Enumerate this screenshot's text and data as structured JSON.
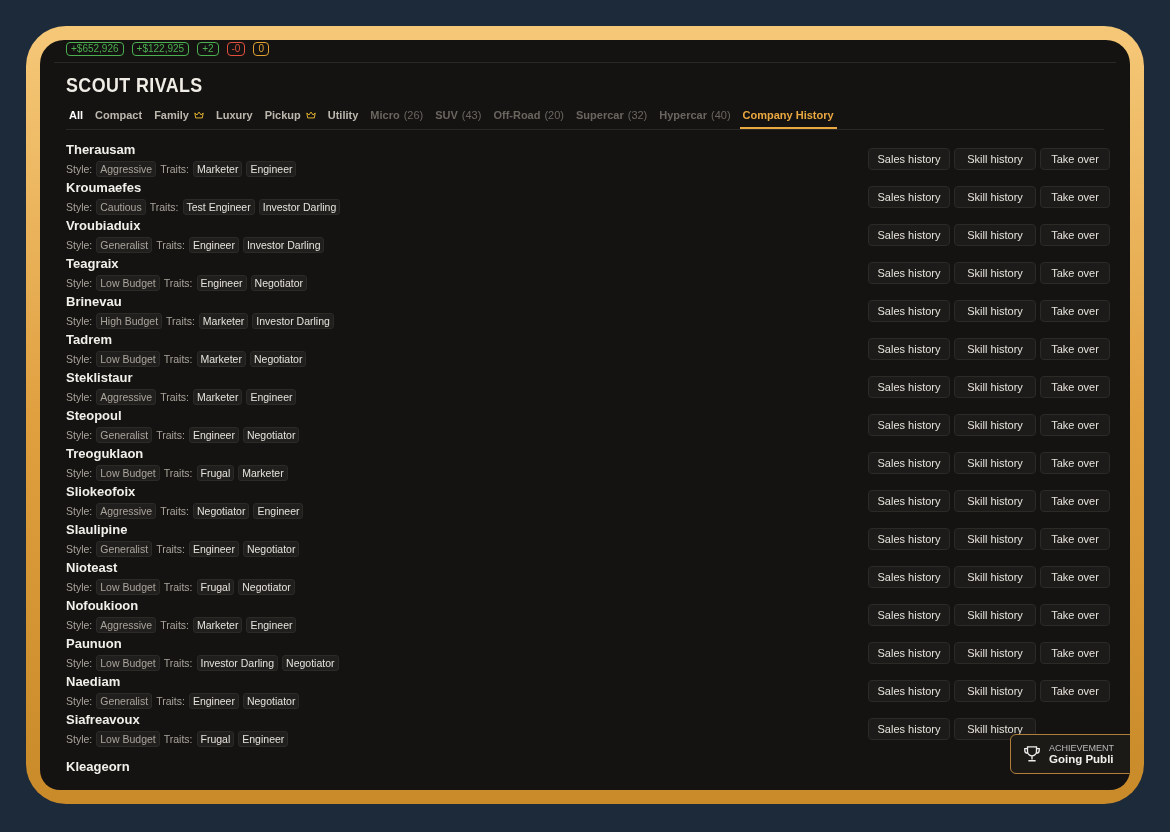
{
  "stats": [
    {
      "text": "+$652,926",
      "color": "#4caf50"
    },
    {
      "text": "+$122,925",
      "color": "#4caf50"
    },
    {
      "text": "+2",
      "color": "#4caf50"
    },
    {
      "text": "-0",
      "color": "#e0503c"
    },
    {
      "text": "0",
      "color": "#e0a030"
    }
  ],
  "title": "SCOUT RIVALS",
  "tabs": [
    {
      "label": "All",
      "kind": "filter",
      "selected": true,
      "disabled": false,
      "crown": false
    },
    {
      "label": "Compact",
      "kind": "filter",
      "selected": false,
      "disabled": false,
      "crown": false
    },
    {
      "label": "Family",
      "kind": "filter",
      "selected": false,
      "disabled": false,
      "crown": true
    },
    {
      "label": "Luxury",
      "kind": "filter",
      "selected": false,
      "disabled": false,
      "crown": false
    },
    {
      "label": "Pickup",
      "kind": "filter",
      "selected": false,
      "disabled": false,
      "crown": true
    },
    {
      "label": "Utility",
      "kind": "filter",
      "selected": false,
      "disabled": false,
      "crown": false
    },
    {
      "label": "Micro",
      "count": "(26)",
      "kind": "filter",
      "selected": false,
      "disabled": true,
      "crown": false
    },
    {
      "label": "SUV",
      "count": "(43)",
      "kind": "filter",
      "selected": false,
      "disabled": true,
      "crown": false
    },
    {
      "label": "Off-Road",
      "count": "(20)",
      "kind": "filter",
      "selected": false,
      "disabled": true,
      "crown": false
    },
    {
      "label": "Supercar",
      "count": "(32)",
      "kind": "filter",
      "selected": false,
      "disabled": true,
      "crown": false
    },
    {
      "label": "Hypercar",
      "count": "(40)",
      "kind": "filter",
      "selected": false,
      "disabled": true,
      "crown": false
    },
    {
      "label": "Company History",
      "kind": "section",
      "selected": true,
      "disabled": false,
      "crown": false
    }
  ],
  "rivals": [
    {
      "name": "Therausam",
      "style_label": "Style:",
      "style": "Aggressive",
      "traits_label": "Traits:",
      "traits": [
        "Marketer",
        "Engineer"
      ],
      "buttons": [
        "Sales history",
        "Skill history",
        "Take over"
      ]
    },
    {
      "name": "Kroumaefes",
      "style_label": "Style:",
      "style": "Cautious",
      "traits_label": "Traits:",
      "traits": [
        "Test Engineer",
        "Investor Darling"
      ],
      "buttons": [
        "Sales history",
        "Skill history",
        "Take over"
      ]
    },
    {
      "name": "Vroubiaduix",
      "style_label": "Style:",
      "style": "Generalist",
      "traits_label": "Traits:",
      "traits": [
        "Engineer",
        "Investor Darling"
      ],
      "buttons": [
        "Sales history",
        "Skill history",
        "Take over"
      ]
    },
    {
      "name": "Teagraix",
      "style_label": "Style:",
      "style": "Low Budget",
      "traits_label": "Traits:",
      "traits": [
        "Engineer",
        "Negotiator"
      ],
      "buttons": [
        "Sales history",
        "Skill history",
        "Take over"
      ]
    },
    {
      "name": "Brinevau",
      "style_label": "Style:",
      "style": "High Budget",
      "traits_label": "Traits:",
      "traits": [
        "Marketer",
        "Investor Darling"
      ],
      "buttons": [
        "Sales history",
        "Skill history",
        "Take over"
      ]
    },
    {
      "name": "Tadrem",
      "style_label": "Style:",
      "style": "Low Budget",
      "traits_label": "Traits:",
      "traits": [
        "Marketer",
        "Negotiator"
      ],
      "buttons": [
        "Sales history",
        "Skill history",
        "Take over"
      ]
    },
    {
      "name": "Steklistaur",
      "style_label": "Style:",
      "style": "Aggressive",
      "traits_label": "Traits:",
      "traits": [
        "Marketer",
        "Engineer"
      ],
      "buttons": [
        "Sales history",
        "Skill history",
        "Take over"
      ]
    },
    {
      "name": "Steopoul",
      "style_label": "Style:",
      "style": "Generalist",
      "traits_label": "Traits:",
      "traits": [
        "Engineer",
        "Negotiator"
      ],
      "buttons": [
        "Sales history",
        "Skill history",
        "Take over"
      ]
    },
    {
      "name": "Treoguklaon",
      "style_label": "Style:",
      "style": "Low Budget",
      "traits_label": "Traits:",
      "traits": [
        "Frugal",
        "Marketer"
      ],
      "buttons": [
        "Sales history",
        "Skill history",
        "Take over"
      ]
    },
    {
      "name": "Sliokeofoix",
      "style_label": "Style:",
      "style": "Aggressive",
      "traits_label": "Traits:",
      "traits": [
        "Negotiator",
        "Engineer"
      ],
      "buttons": [
        "Sales history",
        "Skill history",
        "Take over"
      ]
    },
    {
      "name": "Slaulipine",
      "style_label": "Style:",
      "style": "Generalist",
      "traits_label": "Traits:",
      "traits": [
        "Engineer",
        "Negotiator"
      ],
      "buttons": [
        "Sales history",
        "Skill history",
        "Take over"
      ]
    },
    {
      "name": "Nioteast",
      "style_label": "Style:",
      "style": "Low Budget",
      "traits_label": "Traits:",
      "traits": [
        "Frugal",
        "Negotiator"
      ],
      "buttons": [
        "Sales history",
        "Skill history",
        "Take over"
      ]
    },
    {
      "name": "Nofoukioon",
      "style_label": "Style:",
      "style": "Aggressive",
      "traits_label": "Traits:",
      "traits": [
        "Marketer",
        "Engineer"
      ],
      "buttons": [
        "Sales history",
        "Skill history",
        "Take over"
      ]
    },
    {
      "name": "Paunuon",
      "style_label": "Style:",
      "style": "Low Budget",
      "traits_label": "Traits:",
      "traits": [
        "Investor Darling",
        "Negotiator"
      ],
      "buttons": [
        "Sales history",
        "Skill history",
        "Take over"
      ]
    },
    {
      "name": "Naediam",
      "style_label": "Style:",
      "style": "Generalist",
      "traits_label": "Traits:",
      "traits": [
        "Engineer",
        "Negotiator"
      ],
      "buttons": [
        "Sales history",
        "Skill history",
        "Take over"
      ]
    },
    {
      "name": "Siafreavoux",
      "style_label": "Style:",
      "style": "Low Budget",
      "traits_label": "Traits:",
      "traits": [
        "Frugal",
        "Engineer"
      ],
      "buttons": [
        "Sales history",
        "Skill history"
      ]
    },
    {
      "name": "Kleageorn"
    }
  ],
  "toast": {
    "label": "ACHIEVEMENT",
    "title": "Going Publi"
  }
}
